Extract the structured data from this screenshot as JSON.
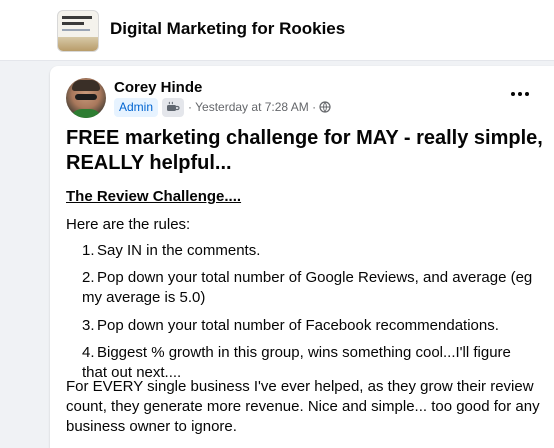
{
  "group": {
    "name": "Digital Marketing for Rookies",
    "thumb_title": "Digital Marketing Rookies"
  },
  "post": {
    "author": "Corey Hinde",
    "role_badge": "Admin",
    "badge_icon": "coffee-cup-icon",
    "timestamp": "· Yesterday at 7:28 AM ·",
    "privacy_icon": "globe-icon",
    "title": "FREE marketing challenge for MAY - really simple, REALLY helpful...",
    "challenge_name": "The Review Challenge....",
    "rules_intro": "Here are the rules:",
    "rules": [
      {
        "num": "1.",
        "text": "Say IN in the comments."
      },
      {
        "num": "2.",
        "text": "Pop down your total number of Google Reviews, and average (eg my average is 5.0)"
      },
      {
        "num": "3.",
        "text": "Pop down your total number of Facebook recommendations."
      },
      {
        "num": "4.",
        "text": "Biggest % growth in this group, wins something cool...I'll figure that out next...."
      }
    ],
    "closing": "For EVERY single business I've ever helped, as they grow their review count, they generate more revenue. Nice and simple... too good for any business owner to ignore."
  },
  "colors": {
    "background": "#f0f2f5",
    "badge_bg": "#e7f3ff",
    "badge_text": "#0064d1",
    "meta_text": "#65676b"
  }
}
